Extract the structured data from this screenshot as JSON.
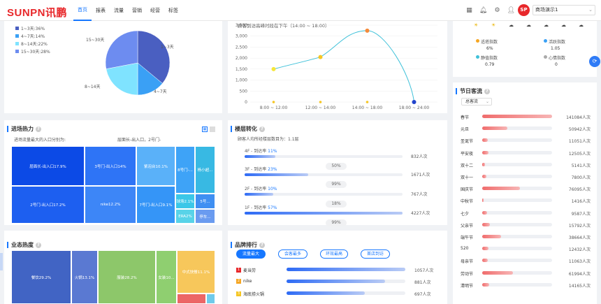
{
  "header": {
    "logo": "SUNPN讯鹏",
    "nav": [
      {
        "label": "首页",
        "active": true
      },
      {
        "label": "报表"
      },
      {
        "label": "流量"
      },
      {
        "label": "营销"
      },
      {
        "label": "经营"
      },
      {
        "label": "标签"
      }
    ],
    "avatar_text": "SP",
    "store": "商场演示1",
    "icons": [
      "grid-icon",
      "bell-icon",
      "gear-icon",
      "user-icon"
    ]
  },
  "stay": {
    "legend": [
      "1~3天:36%",
      "4~7天:14%",
      "8~14天:22%",
      "15~30天:28%"
    ],
    "slices": [
      {
        "label": "1~3天",
        "value": 36,
        "color": "#4a5fc1"
      },
      {
        "label": "4~7天",
        "value": 14,
        "color": "#3aa0f5"
      },
      {
        "label": "8~14天",
        "value": 22,
        "color": "#7fe3ff"
      },
      {
        "label": "15~30天",
        "value": 28,
        "color": "#6d8cf0"
      }
    ]
  },
  "peak": {
    "title": "顾客到访高峰时段在下午（14:00 ~ 18:00）",
    "yticks": [
      "3,500",
      "3,000",
      "2,500",
      "2,000",
      "1,500",
      "1,000",
      "500",
      "0"
    ],
    "xticks": [
      "8:00 ~ 12:00",
      "12:00 ~ 14:00",
      "14:00 ~ 18:00",
      "18:00 ~ 24:00"
    ]
  },
  "chart_data": {
    "type": "line",
    "categories": [
      "8:00 ~ 12:00",
      "12:00 ~ 14:00",
      "14:00 ~ 18:00",
      "18:00 ~ 24:00"
    ],
    "values": [
      1500,
      2050,
      3250,
      0
    ],
    "ylim": [
      0,
      3500
    ]
  },
  "indices": {
    "weather": [
      "☀",
      "☀",
      "☁",
      "☁",
      "☁",
      "☁",
      "☁"
    ],
    "items": [
      {
        "label": "适塔指数",
        "value": "6%"
      },
      {
        "label": "活跃指数",
        "value": "1.05"
      },
      {
        "label": "静值指数",
        "value": "0.79"
      },
      {
        "label": "心情指数",
        "value": "0"
      }
    ]
  },
  "entry": {
    "title": "进场热力",
    "subtitle": "进场流量最大的入口分别为:",
    "top": "层面长-出入口，2号门-",
    "cells": [
      "层面长-出入口17.9%",
      "3号门-出入口14%",
      "紫泡台10.1%",
      "8号门-...",
      "杨小超...",
      "2号门-出入口17.2%",
      "nike12.2%",
      "7号门-出入口9.1%",
      "球场2.1%",
      "5号...",
      "ERA2%",
      "停车..."
    ]
  },
  "floor": {
    "title": "楼层转化",
    "subtitle": "顾客人均所经楼层数目为：1.1层",
    "rows": [
      {
        "label": "4F - 到达率",
        "pct": "11%",
        "fill": 0.11,
        "count": "832人次"
      },
      {
        "label": "3F - 到达率",
        "pct": "23%",
        "fill": 0.23,
        "count": "1671人次"
      },
      {
        "label": "2F - 到达率",
        "pct": "10%",
        "fill": 0.1,
        "count": "767人次"
      },
      {
        "label": "1F - 到达率",
        "pct": "57%",
        "fill": 0.57,
        "count": "4227人次"
      }
    ],
    "conversions": [
      "50%",
      "99%",
      "18%",
      "99%"
    ]
  },
  "holiday": {
    "title": "节日客流",
    "select": "总客流",
    "rows": [
      {
        "name": "春节",
        "value": "141084人次",
        "fill": 1
      },
      {
        "name": "元旦",
        "value": "50942人次",
        "fill": 0.36
      },
      {
        "name": "圣诞节",
        "value": "11051人次",
        "fill": 0.08
      },
      {
        "name": "平安夜",
        "value": "12505人次",
        "fill": 0.09
      },
      {
        "name": "双十二",
        "value": "5141人次",
        "fill": 0.04
      },
      {
        "name": "双十一",
        "value": "7800人次",
        "fill": 0.06
      },
      {
        "name": "国庆节",
        "value": "76095人次",
        "fill": 0.54
      },
      {
        "name": "中秋节",
        "value": "1416人次",
        "fill": 0.01
      },
      {
        "name": "七夕",
        "value": "9587人次",
        "fill": 0.07
      },
      {
        "name": "父亲节",
        "value": "15792人次",
        "fill": 0.11
      },
      {
        "name": "端午节",
        "value": "38664人次",
        "fill": 0.27
      },
      {
        "name": "520",
        "value": "12432人次",
        "fill": 0.09
      },
      {
        "name": "母亲节",
        "value": "11063人次",
        "fill": 0.08
      },
      {
        "name": "劳动节",
        "value": "61994人次",
        "fill": 0.44
      },
      {
        "name": "清明节",
        "value": "14165人次",
        "fill": 0.1
      }
    ]
  },
  "business": {
    "title": "业态热度",
    "cells": [
      "餐饮29.2%",
      "火锅13.1%",
      "服装28.2%",
      "女装10...",
      "中式快餐11.1%"
    ]
  },
  "brand": {
    "title": "品牌排行",
    "buttons": [
      "流量最大",
      "会客最多",
      "环效最高",
      "首店到访"
    ],
    "rows": [
      {
        "rank": "1",
        "name": "麦当劳",
        "value": "1057人次",
        "fill": 1,
        "color": "#e8282b"
      },
      {
        "rank": "2",
        "name": "nike",
        "value": "881人次",
        "fill": 0.83,
        "color": "#f5a623"
      },
      {
        "rank": "3",
        "name": "海底捞火锅",
        "value": "697人次",
        "fill": 0.66,
        "color": "#f5c623"
      }
    ]
  }
}
